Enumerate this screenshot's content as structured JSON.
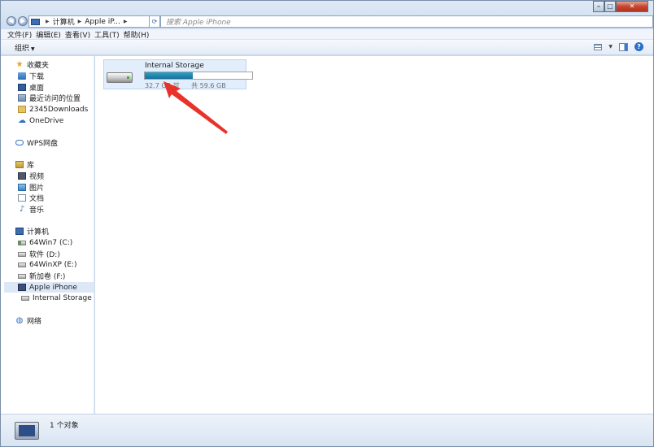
{
  "addressbar": {
    "crumbs": [
      "计算机",
      "Apple iP..."
    ],
    "search_placeholder": "搜索 Apple iPhone"
  },
  "menubar": {
    "items": [
      "文件(F)",
      "编辑(E)",
      "查看(V)",
      "工具(T)",
      "帮助(H)"
    ]
  },
  "toolbar": {
    "organize_label": "组织"
  },
  "sidebar": {
    "favorites": {
      "label": "收藏夹",
      "items": [
        "下载",
        "桌面",
        "最近访问的位置",
        "2345Downloads",
        "OneDrive"
      ]
    },
    "wps": "WPS网盘",
    "libraries": {
      "label": "库",
      "items": [
        "视频",
        "图片",
        "文档",
        "音乐"
      ]
    },
    "computer": {
      "label": "计算机",
      "items": [
        "64Win7  (C:)",
        "软件 (D:)",
        "64WinXP  (E:)",
        "新加卷 (F:)",
        "Apple iPhone",
        "Internal Storage"
      ]
    },
    "network": "网络"
  },
  "content": {
    "tile": {
      "name": "Internal Storage",
      "free_text": "32.7 GB 可",
      "total_text": "共 59.6 GB",
      "used_fraction": 0.45
    }
  },
  "statusbar": {
    "count_text": "1 个对象"
  },
  "colors": {
    "accent": "#166f9c",
    "selection": "#dce8f6",
    "arrow": "#e8322a",
    "close": "#c6452e"
  }
}
